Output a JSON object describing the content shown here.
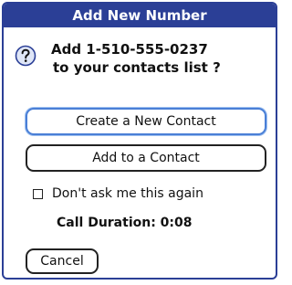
{
  "dialog": {
    "title": "Add New Number",
    "icon": "question-icon",
    "message_line1": "Add 1-510-555-0237",
    "message_line2": "to your contacts list ?"
  },
  "buttons": {
    "create_label": "Create a New Contact",
    "add_label": "Add to a Contact",
    "cancel_label": "Cancel"
  },
  "checkbox": {
    "label": "Don't ask me this again",
    "checked": false
  },
  "call_duration": "Call Duration: 0:08",
  "colors": {
    "titlebar": "#2b3f96",
    "focus": "#4a7fd6"
  }
}
